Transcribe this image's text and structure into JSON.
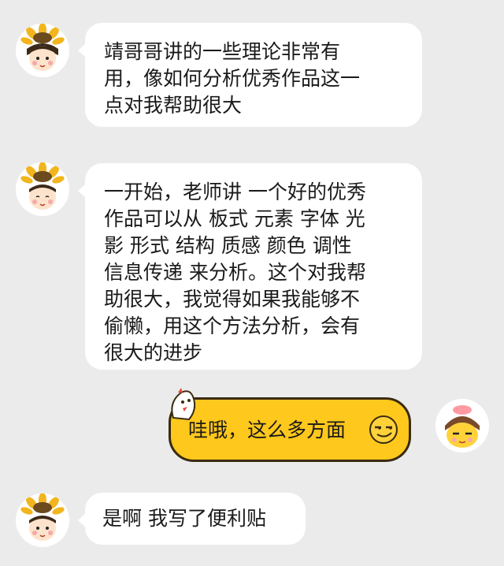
{
  "messages": [
    {
      "sender": "left",
      "avatar": "sunflower-girl-avatar",
      "text": "靖哥哥讲的一些理论非常有\n用，像如何分析优秀作品这一\n点对我帮助很大"
    },
    {
      "sender": "left",
      "avatar": "sunflower-girl-avatar",
      "text": "一开始，老师讲 一个好的优秀\n作品可以从 板式 元素 字体 光\n影 形式 结构 质感 颜色 调性\n信息传递 来分析。这个对我帮\n助很大，我觉得如果我能够不\n偷懒，用这个方法分析，会有\n很大的进步"
    },
    {
      "sender": "right",
      "avatar": "chick-girl-avatar",
      "text": "哇哦，这么多方面",
      "emoji": "smirk-emoji"
    },
    {
      "sender": "left",
      "avatar": "sunflower-girl-avatar",
      "text": "是啊 我写了便利贴"
    }
  ],
  "colors": {
    "background": "#ebebeb",
    "bubble_left": "#ffffff",
    "bubble_right": "#ffc81c",
    "text": "#1a1a1a"
  }
}
